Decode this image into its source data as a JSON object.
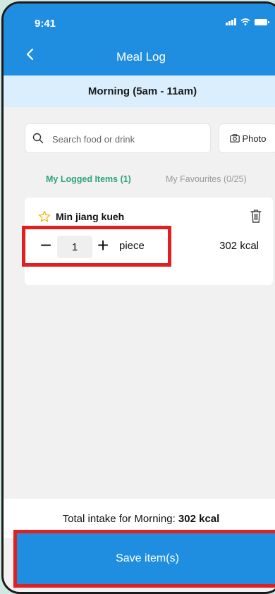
{
  "status_bar": {
    "time": "9:41"
  },
  "header": {
    "title": "Meal Log"
  },
  "period": {
    "label": "Morning (5am - 11am)"
  },
  "search": {
    "placeholder": "Search food or drink",
    "photo_label": "Photo"
  },
  "tabs": [
    {
      "label": "My Logged Items (1)",
      "active": true
    },
    {
      "label": "My Favourites (0/25)",
      "active": false
    }
  ],
  "items": [
    {
      "name": "Min jiang kueh",
      "quantity": "1",
      "unit": "piece",
      "calories": "302 kcal"
    }
  ],
  "total": {
    "prefix": "Total intake for Morning:",
    "value": "302 kcal"
  },
  "save": {
    "label": "Save item(s)"
  },
  "colors": {
    "primary": "#1f8ee0",
    "accent_green": "#2ea37e",
    "highlight_red": "#e02020",
    "period_bg": "#dbeefe"
  },
  "icons": [
    "back-icon",
    "search-icon",
    "camera-icon",
    "star-icon",
    "trash-icon"
  ]
}
